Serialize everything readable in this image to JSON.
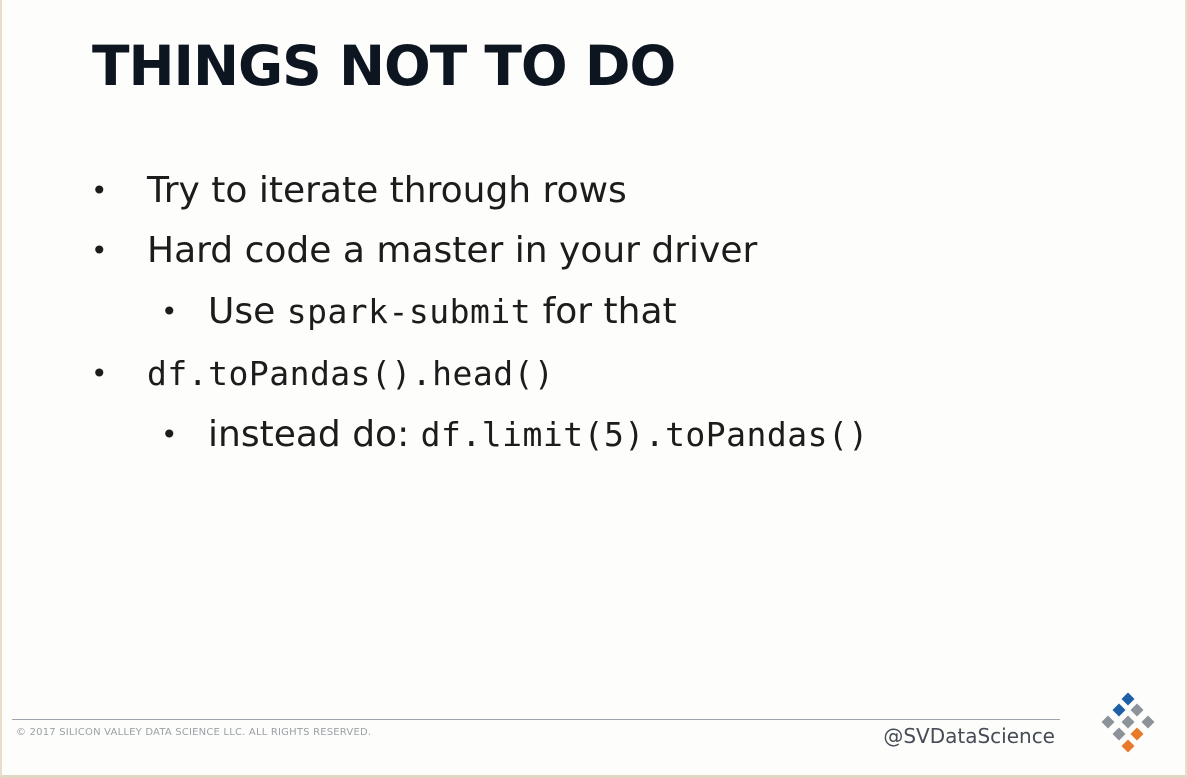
{
  "slide": {
    "title": "THINGS NOT TO DO",
    "bullets": [
      {
        "text": "Try to iterate through rows"
      },
      {
        "text": "Hard code a master in your driver"
      },
      {
        "prefix": "Use ",
        "code": "spark-submit",
        "suffix": " for that"
      },
      {
        "code": "df.toPandas().head()"
      },
      {
        "prefix": "instead do: ",
        "code": "df.limit(5).toPandas()"
      }
    ],
    "bullet_glyph": "•"
  },
  "footer": {
    "copyright": "© 2017 SILICON VALLEY DATA SCIENCE LLC. ALL RIGHTS RESERVED.",
    "handle": "@SVDataScience"
  },
  "logo": {
    "icon": "svds-diamond-logo-icon",
    "colors": {
      "blue": "#1f5fa8",
      "gray": "#8c9399",
      "orange": "#e8782a"
    }
  }
}
